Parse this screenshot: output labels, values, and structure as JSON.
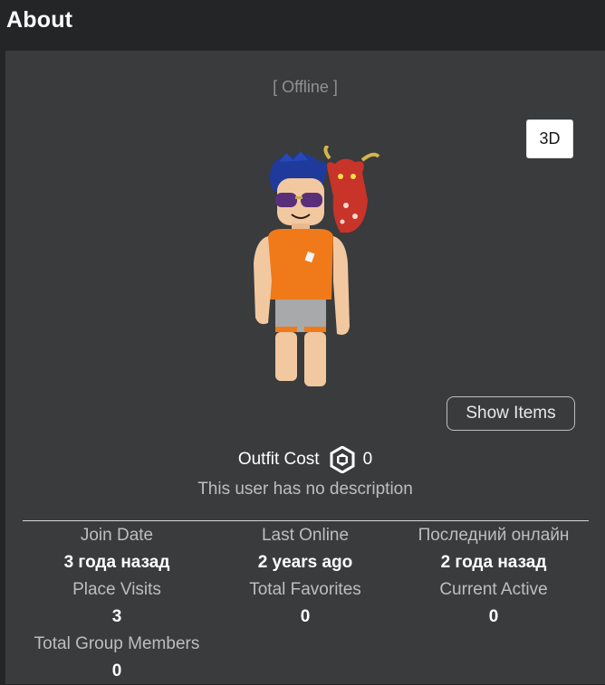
{
  "header": {
    "title": "About"
  },
  "profile": {
    "presence": "[ Offline ]",
    "view_toggle_label": "3D",
    "show_items_label": "Show Items",
    "outfit_cost_label": "Outfit Cost",
    "outfit_cost_value": "0",
    "outfit_cost_icon": "robux-icon",
    "description": "This user has no description"
  },
  "stats": [
    {
      "label": "Join Date",
      "value": "3 года назад"
    },
    {
      "label": "Last Online",
      "value": "2 years ago"
    },
    {
      "label": "Последний онлайн",
      "value": "2 года назад"
    },
    {
      "label": "Place Visits",
      "value": "3"
    },
    {
      "label": "Total Favorites",
      "value": "0"
    },
    {
      "label": "Current Active",
      "value": "0"
    },
    {
      "label": "Total Group Members",
      "value": "0"
    }
  ],
  "colors": {
    "header_bg": "#232527",
    "panel_bg": "#393b3d",
    "muted_text": "#bdbebe",
    "offline_text": "#8f9193"
  }
}
